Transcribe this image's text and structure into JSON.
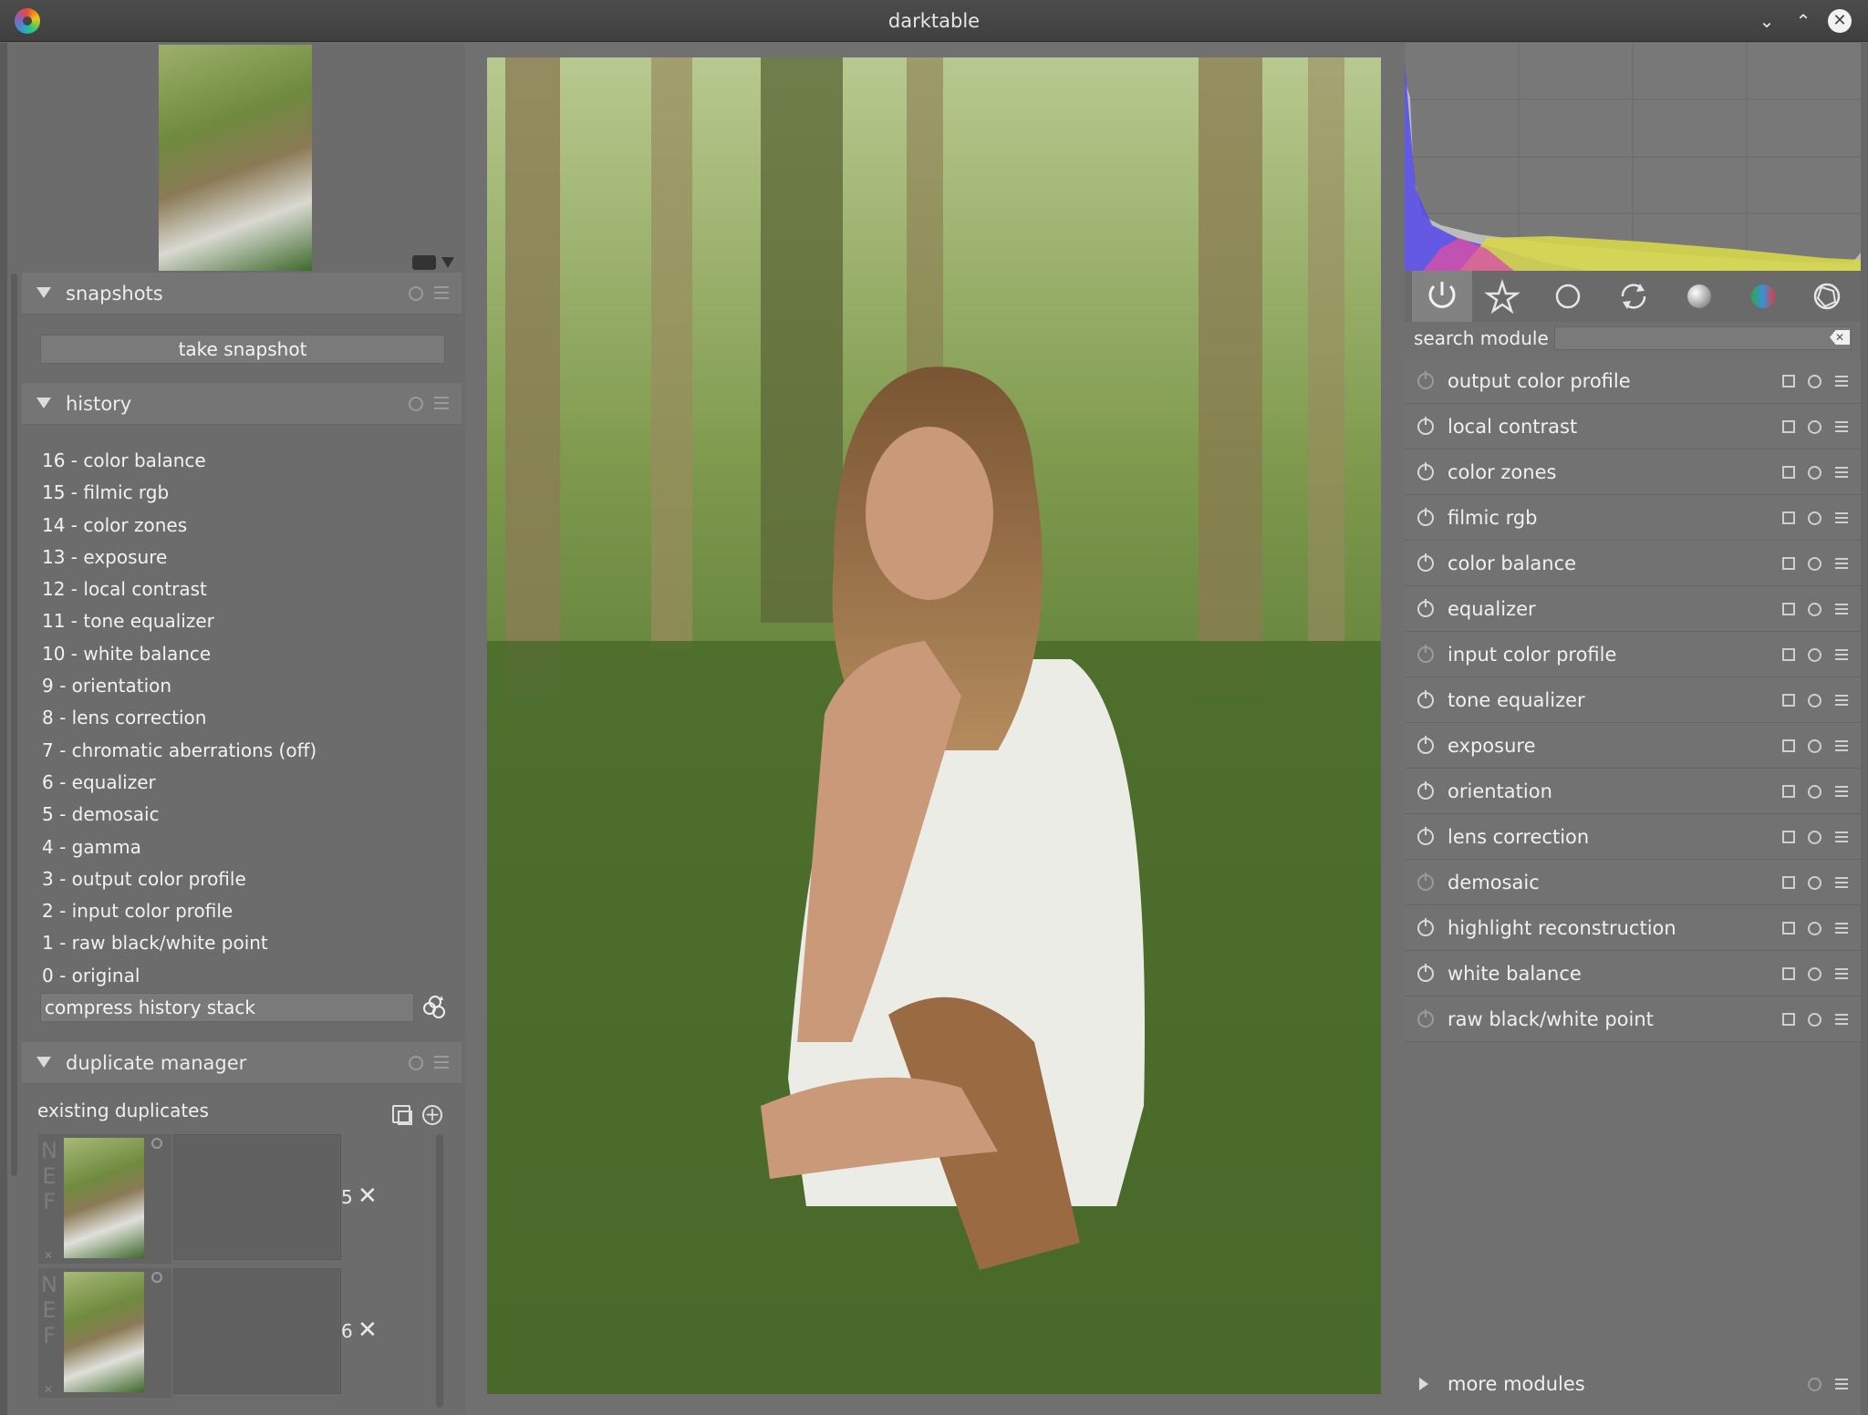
{
  "window": {
    "title": "darktable"
  },
  "left_panel": {
    "snapshots": {
      "title": "snapshots",
      "take_snapshot_label": "take snapshot"
    },
    "history": {
      "title": "history",
      "items": [
        "16 - color balance",
        "15 - filmic rgb",
        "14 - color zones",
        "13 - exposure",
        "12 - local contrast",
        "11 - tone equalizer",
        "10 - white balance",
        "9 - orientation",
        "8 - lens correction",
        "7 - chromatic aberrations (off)",
        "6 - equalizer",
        "5 - demosaic",
        "4 - gamma",
        "3 - output color profile",
        "2 - input color profile",
        "1 - raw black/white point",
        "0 - original"
      ],
      "compress_label": "compress history stack"
    },
    "duplicate_manager": {
      "title": "duplicate manager",
      "existing_label": "existing duplicates",
      "items": [
        {
          "side_letters": "N\nE\nF",
          "version": "5",
          "delete_symbol": "✕"
        },
        {
          "side_letters": "N\nE\nF",
          "version": "6",
          "delete_symbol": "✕"
        }
      ]
    }
  },
  "right_panel": {
    "search_label": "search module",
    "search_value": "",
    "tabs": [
      "power-icon",
      "star-icon",
      "circle-icon",
      "rotate-icon",
      "sphere-icon",
      "color-wheel-icon",
      "aperture-icon"
    ],
    "modules": [
      {
        "name": "output color profile",
        "enabled": false
      },
      {
        "name": "local contrast",
        "enabled": true
      },
      {
        "name": "color zones",
        "enabled": true
      },
      {
        "name": "filmic rgb",
        "enabled": true
      },
      {
        "name": "color balance",
        "enabled": true
      },
      {
        "name": "equalizer",
        "enabled": true
      },
      {
        "name": "input color profile",
        "enabled": false
      },
      {
        "name": "tone equalizer",
        "enabled": true
      },
      {
        "name": "exposure",
        "enabled": true
      },
      {
        "name": "orientation",
        "enabled": true
      },
      {
        "name": "lens correction",
        "enabled": true
      },
      {
        "name": "demosaic",
        "enabled": false
      },
      {
        "name": "highlight reconstruction",
        "enabled": true
      },
      {
        "name": "white balance",
        "enabled": true
      },
      {
        "name": "raw black/white point",
        "enabled": false
      }
    ],
    "more_modules_label": "more modules"
  },
  "colors": {
    "panel_bg": "#6e6e6e",
    "titlebar_bg": "#444444",
    "text": "#f0f0f0"
  }
}
